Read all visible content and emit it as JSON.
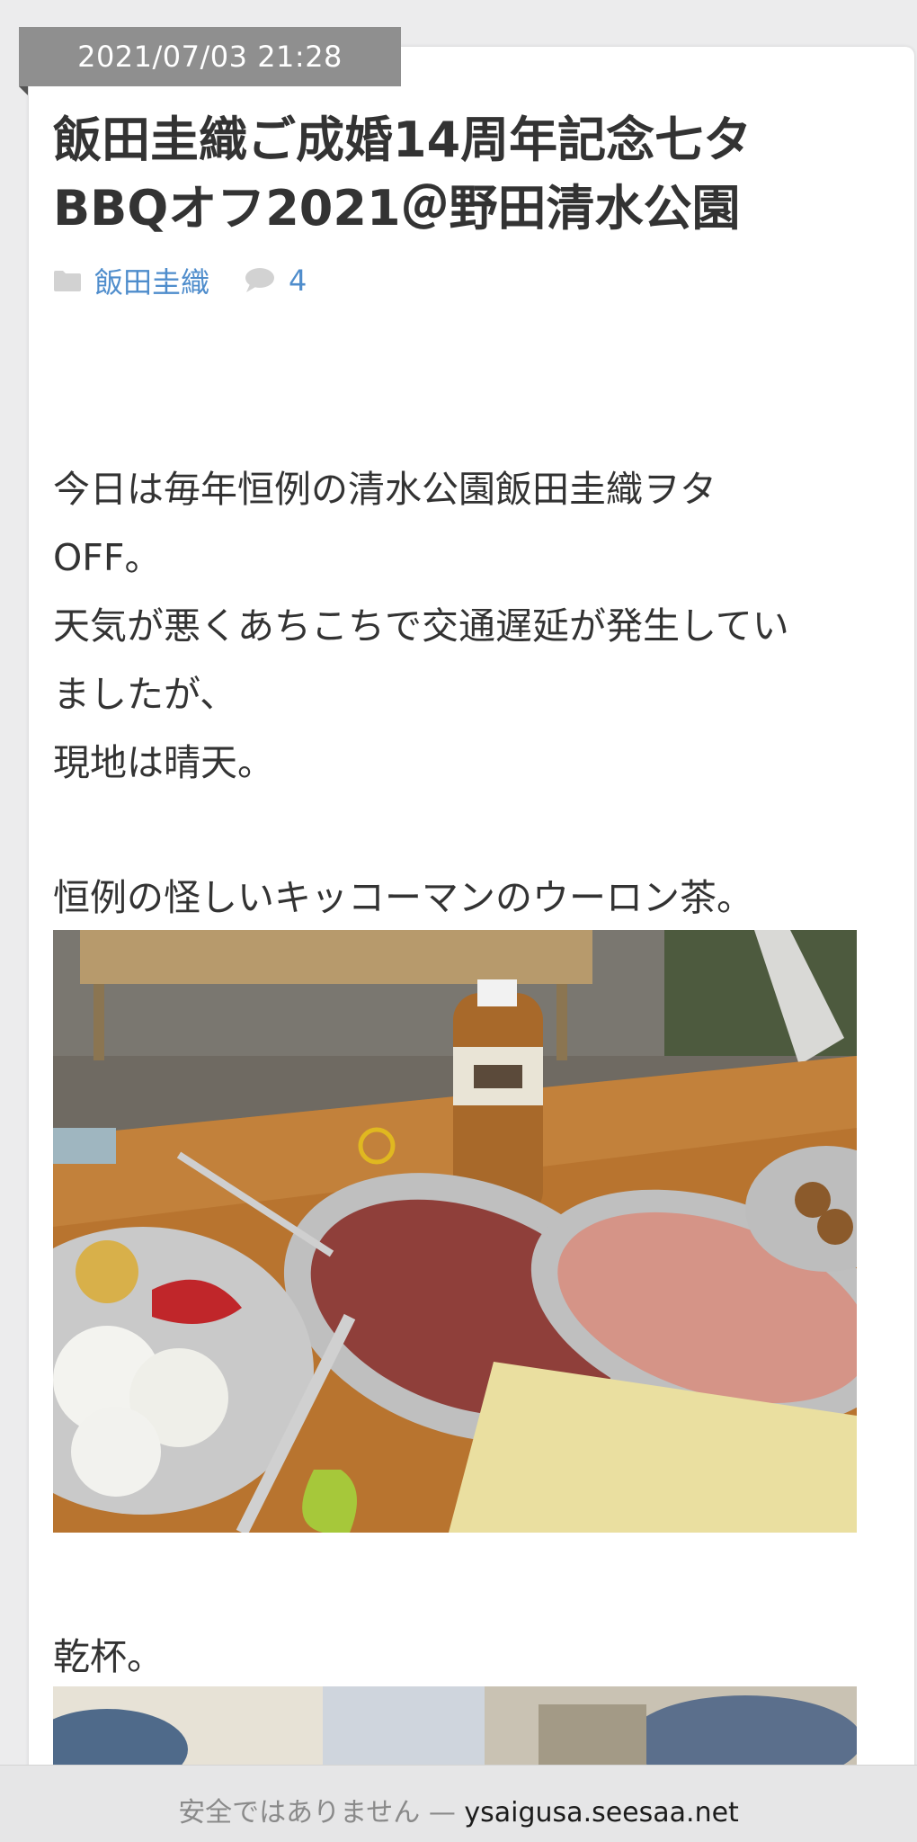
{
  "post": {
    "date": "2021/07/03 21:28",
    "title_line1": "飯田圭織ご成婚14周年記念七タ",
    "title_line2": "BBQオフ2021＠野田清水公園",
    "category": "飯田圭織",
    "comment_count": "4"
  },
  "body": {
    "para1_line1": "今日は毎年恒例の清水公園飯田圭織ヲタ",
    "para1_line2": "OFF。",
    "para1_line3": "天気が悪くあちこちで交通遅延が発生してい",
    "para1_line4": "ましたが、",
    "para1_line5": "現地は晴天。",
    "para2": "恒例の怪しいキッコーマンのウーロン茶。",
    "para3": "乾杯。"
  },
  "browser": {
    "security_label": "安全ではありません",
    "separator": "—",
    "domain": "ysaigusa.seesaa.net"
  },
  "icons": {
    "category": "folder-icon",
    "comments": "comment-icon"
  },
  "colors": {
    "link": "#4f8dcc",
    "date_badge": "#8f8f8f",
    "text": "#333333"
  }
}
